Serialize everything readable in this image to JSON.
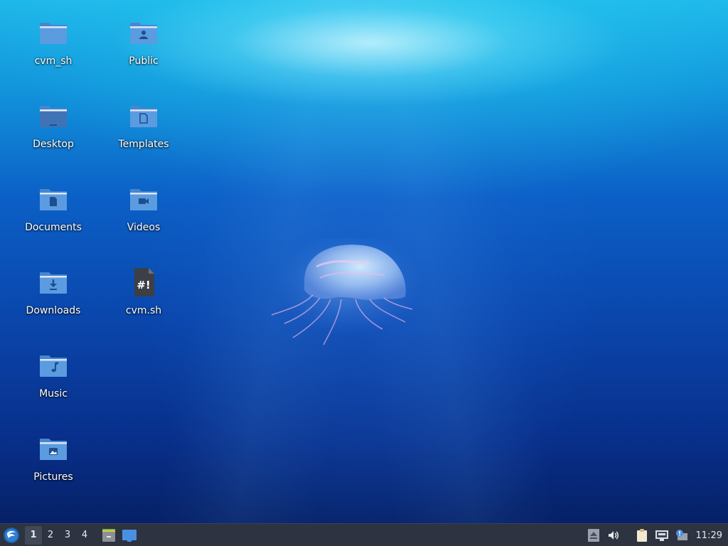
{
  "desktop": {
    "icons": [
      {
        "label": "cvm_sh",
        "icon": "folder-icon"
      },
      {
        "label": "Public",
        "icon": "folder-public-icon"
      },
      {
        "label": "Desktop",
        "icon": "folder-desktop-icon"
      },
      {
        "label": "Templates",
        "icon": "folder-templates-icon"
      },
      {
        "label": "Documents",
        "icon": "folder-documents-icon"
      },
      {
        "label": "Videos",
        "icon": "folder-videos-icon"
      },
      {
        "label": "Downloads",
        "icon": "folder-downloads-icon"
      },
      {
        "label": "cvm.sh",
        "icon": "shell-script-icon"
      },
      {
        "label": "Music",
        "icon": "folder-music-icon"
      },
      {
        "label": "Pictures",
        "icon": "folder-pictures-icon"
      }
    ]
  },
  "taskbar": {
    "menu_icon": "lxqt-menu-icon",
    "workspaces": [
      "1",
      "2",
      "3",
      "4"
    ],
    "active_workspace": "1",
    "quicklaunch": [
      "file-manager-icon",
      "show-desktop-icon"
    ],
    "tray": [
      "volume-eject-icon",
      "volume-icon",
      "clipboard-icon",
      "network-icon",
      "update-notifier-icon"
    ],
    "clock": "11:29"
  },
  "colors": {
    "folder": "#5b9be0",
    "folder_tab": "#4a86cc",
    "folder_light": "#e8f0fb",
    "folder_symbol": "#1d4f8c",
    "taskbar_bg": "#2d3340",
    "taskbar_text": "#e6e9ef"
  }
}
